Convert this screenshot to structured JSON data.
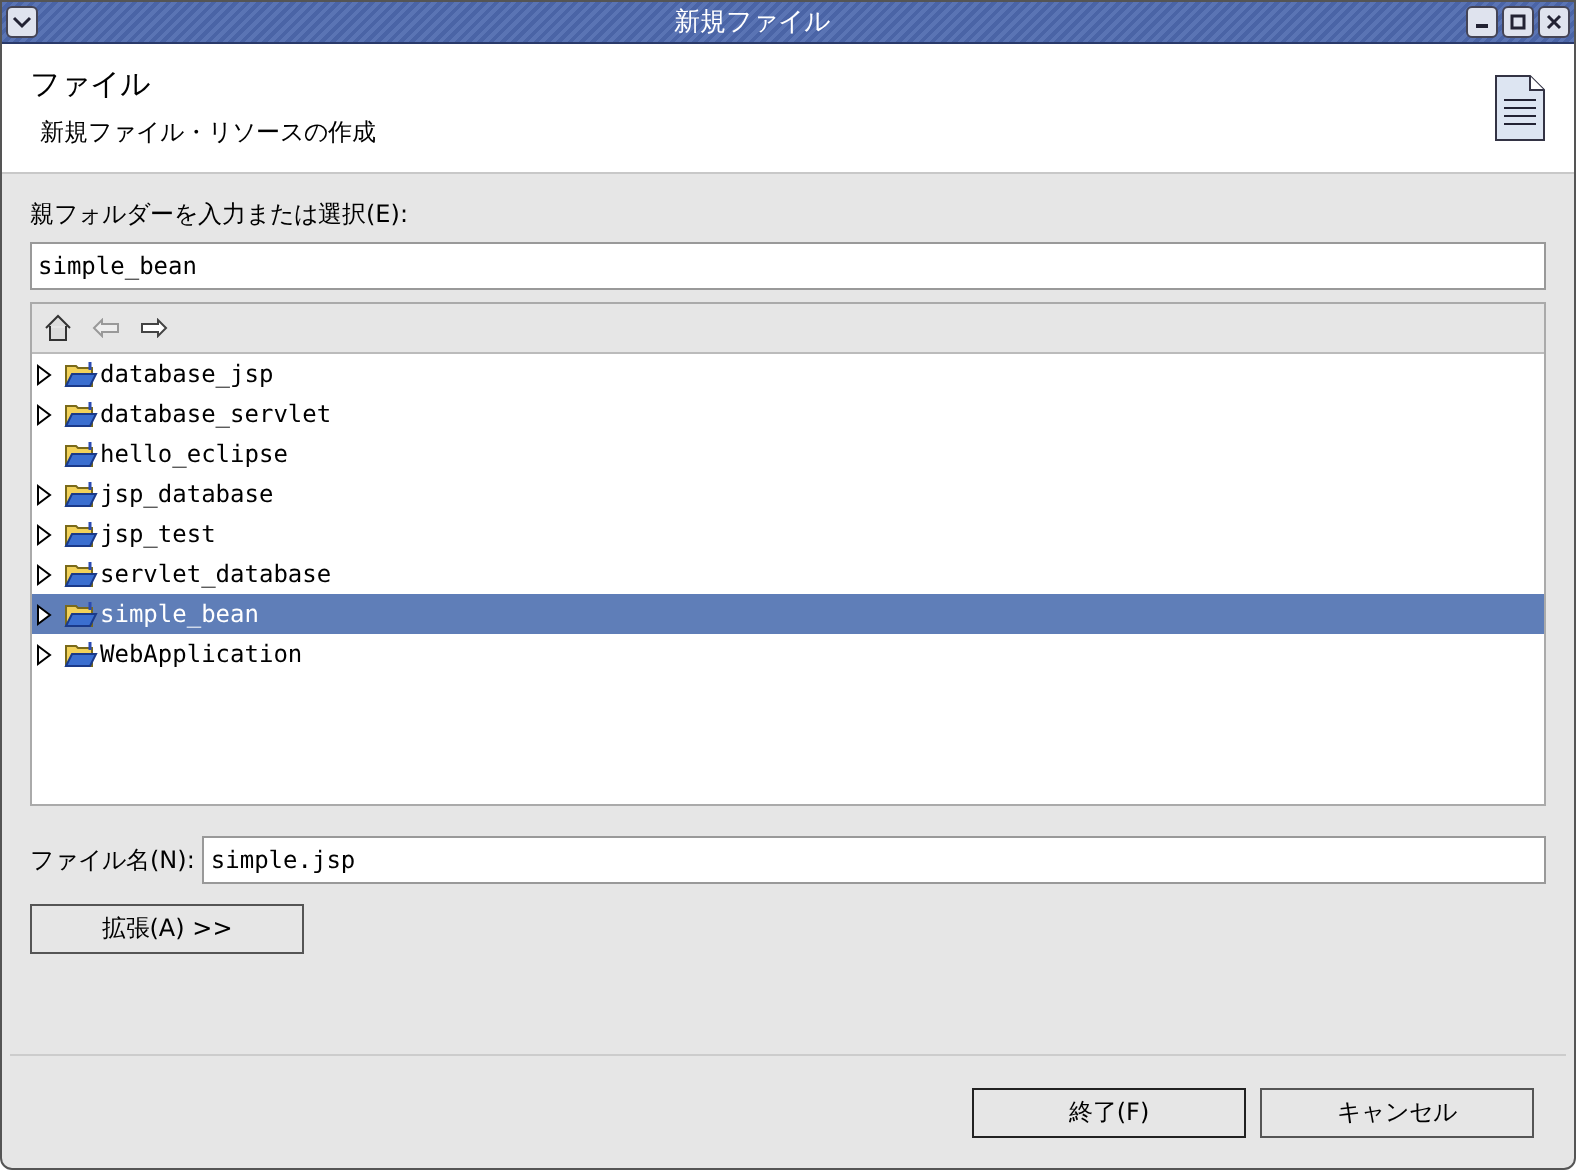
{
  "window": {
    "title": "新規ファイル"
  },
  "header": {
    "title": "ファイル",
    "description": "新規ファイル・リソースの作成"
  },
  "parent_folder": {
    "label": "親フォルダーを入力または選択(E):",
    "value": "simple_bean"
  },
  "tree": {
    "items": [
      {
        "label": "database_jsp",
        "expandable": true,
        "selected": false
      },
      {
        "label": "database_servlet",
        "expandable": true,
        "selected": false
      },
      {
        "label": "hello_eclipse",
        "expandable": false,
        "selected": false
      },
      {
        "label": "jsp_database",
        "expandable": true,
        "selected": false
      },
      {
        "label": "jsp_test",
        "expandable": true,
        "selected": false
      },
      {
        "label": "servlet_database",
        "expandable": true,
        "selected": false
      },
      {
        "label": "simple_bean",
        "expandable": true,
        "selected": true
      },
      {
        "label": "WebApplication",
        "expandable": true,
        "selected": false
      }
    ]
  },
  "file_name": {
    "label": "ファイル名(N):",
    "value": "simple.jsp"
  },
  "advanced_button": "拡張(A) >>",
  "buttons": [
    "終了(F)",
    "キャンセル"
  ]
}
